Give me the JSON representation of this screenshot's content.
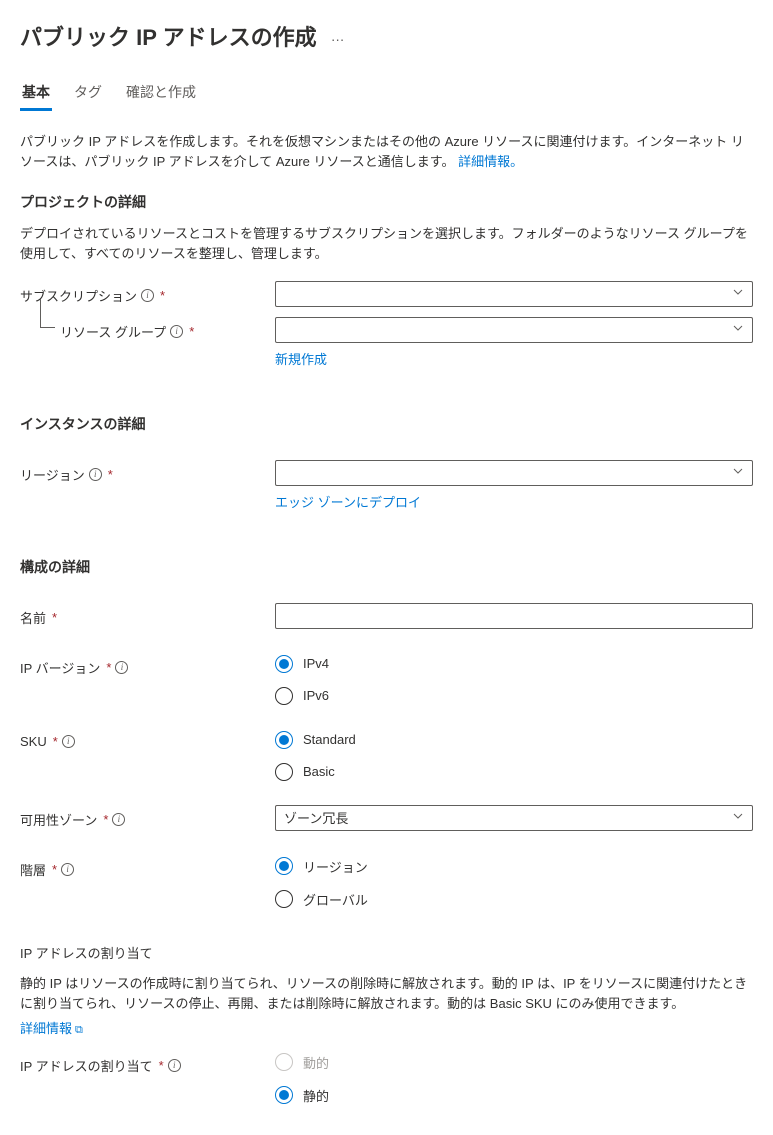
{
  "header": {
    "title": "パブリック IP アドレスの作成",
    "more": "…"
  },
  "tabs": [
    {
      "label": "基本",
      "active": true
    },
    {
      "label": "タグ",
      "active": false
    },
    {
      "label": "確認と作成",
      "active": false
    }
  ],
  "intro": {
    "text": "パブリック IP アドレスを作成します。それを仮想マシンまたはその他の Azure リソースに関連付けます。インターネット リソースは、パブリック IP アドレスを介して Azure リソースと通信します。 ",
    "linkText": "詳細情報。"
  },
  "sections": {
    "project": {
      "heading": "プロジェクトの詳細",
      "desc": "デプロイされているリソースとコストを管理するサブスクリプションを選択します。フォルダーのようなリソース グループを使用して、すべてのリソースを整理し、管理します。",
      "subscriptionLabel": "サブスクリプション",
      "resourceGroupLabel": "リソース グループ",
      "newLink": "新規作成"
    },
    "instance": {
      "heading": "インスタンスの詳細",
      "regionLabel": "リージョン",
      "edgeLink": "エッジ ゾーンにデプロイ"
    },
    "config": {
      "heading": "構成の詳細",
      "nameLabel": "名前",
      "ipVersionLabel": "IP バージョン",
      "ipv4": "IPv4",
      "ipv6": "IPv6",
      "skuLabel": "SKU",
      "skuStandard": "Standard",
      "skuBasic": "Basic",
      "zoneLabel": "可用性ゾーン",
      "zoneValue": "ゾーン冗長",
      "tierLabel": "階層",
      "tierRegion": "リージョン",
      "tierGlobal": "グローバル"
    },
    "ipAssign": {
      "heading": "IP アドレスの割り当て",
      "desc": "静的 IP はリソースの作成時に割り当てられ、リソースの削除時に解放されます。動的 IP は、IP をリソースに関連付けたときに割り当てられ、リソースの停止、再開、または削除時に解放されます。動的は Basic SKU にのみ使用できます。",
      "moreInfo": "詳細情報",
      "assignLabel": "IP アドレスの割り当て",
      "dynamic": "動的",
      "static": "静的"
    }
  }
}
